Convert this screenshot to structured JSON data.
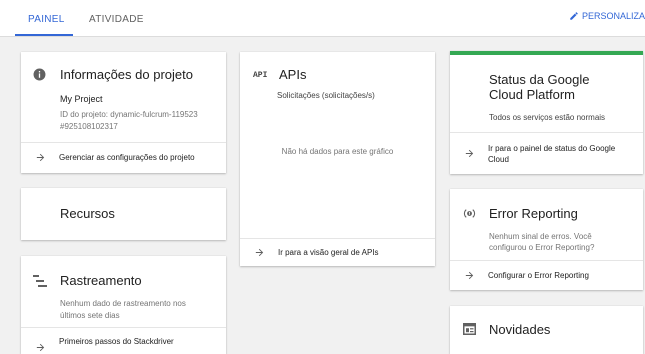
{
  "tabs": [
    {
      "label": "PAINEL",
      "active": true
    },
    {
      "label": "ATIVIDADE",
      "active": false
    }
  ],
  "customize_label": "PERSONALIZA",
  "project_info": {
    "title": "Informações do projeto",
    "project_name": "My Project",
    "project_id": "ID do projeto: dynamic-fulcrum-119523",
    "project_number": "#925108102317",
    "link": "Gerenciar as configurações do projeto"
  },
  "resources": {
    "title": "Recursos"
  },
  "tracing": {
    "title": "Rastreamento",
    "message_line1": "Nenhum dado de rastreamento nos",
    "message_line2": "últimos sete dias",
    "link": "Primeiros passos do Stackdriver"
  },
  "apis": {
    "icon_text": "API",
    "title": "APIs",
    "subtitle": "Solicitações (solicitações/s)",
    "empty": "Não há dados para este gráfico",
    "link": "Ir para a visão geral de APIs"
  },
  "status": {
    "title_line1": "Status da Google",
    "title_line2": "Cloud Platform",
    "message": "Todos os serviços estão normais",
    "link_line1": "Ir para o painel de status do Google",
    "link_line2": "Cloud",
    "accent": "#34a853"
  },
  "error_reporting": {
    "title": "Error Reporting",
    "message_line1": "Nenhum sinal de erros. Você",
    "message_line2": "configurou o Error Reporting?",
    "link": "Configurar o Error Reporting"
  },
  "news": {
    "title": "Novidades"
  },
  "colors": {
    "accent_blue": "#3367d6",
    "background": "#f1f1f1"
  }
}
